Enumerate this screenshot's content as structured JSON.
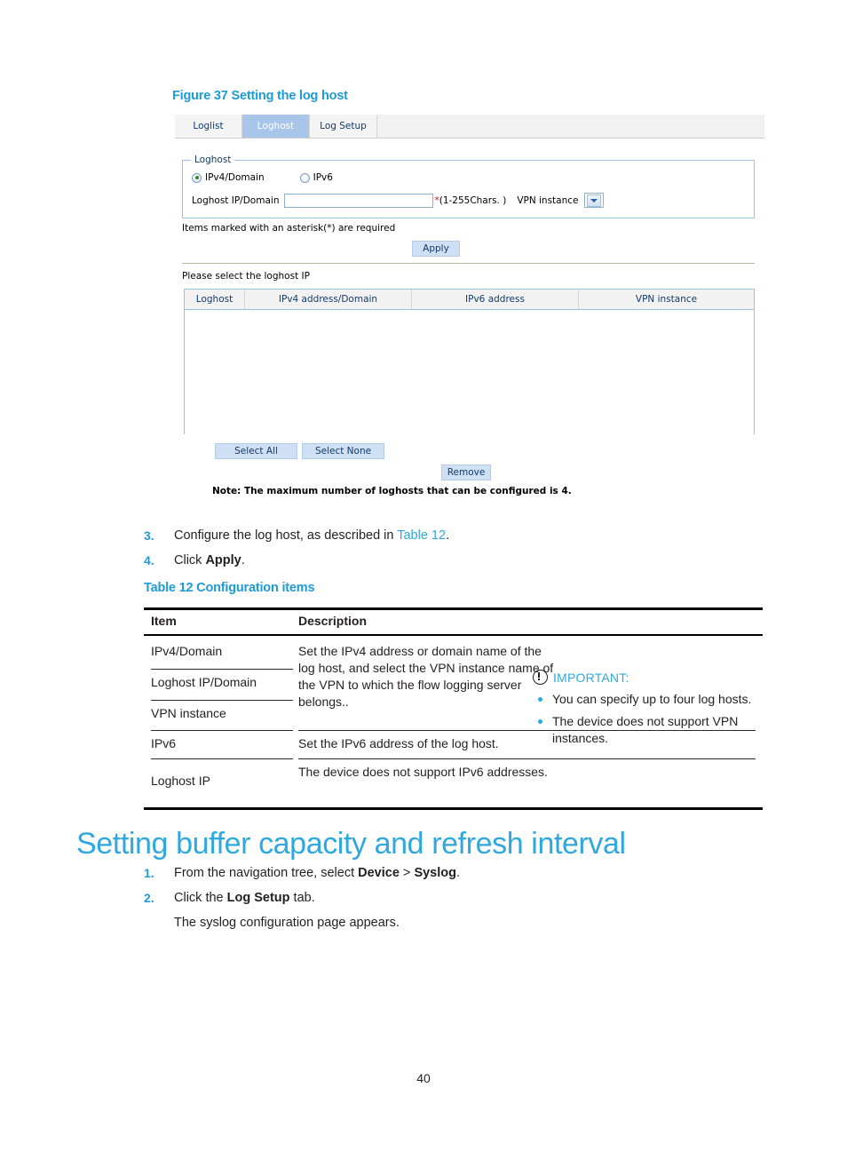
{
  "figure": {
    "caption": "Figure 37 Setting the log host",
    "tabs": [
      {
        "label": "Loglist",
        "active": false
      },
      {
        "label": "Loghost",
        "active": true
      },
      {
        "label": "Log Setup",
        "active": false
      }
    ],
    "fieldset": {
      "legend": "Loghost",
      "radios": [
        {
          "label": "IPv4/Domain",
          "checked": true
        },
        {
          "label": "IPv6",
          "checked": false
        }
      ],
      "field_label": "Loghost IP/Domain",
      "field_value": "",
      "field_placeholder": "",
      "asterisk": "*",
      "hint": "(1-255Chars. )",
      "vpn_label": "VPN instance",
      "vpn_value": ""
    },
    "required_note": "Items marked with an asterisk(*) are required",
    "apply_label": "Apply",
    "select_prompt": "Please select the loghost IP",
    "grid": {
      "headers": [
        "Loghost",
        "IPv4 address/Domain",
        "IPv6 address",
        "VPN instance"
      ],
      "rows": []
    },
    "select_all_label": "Select All",
    "select_none_label": "Select None",
    "remove_label": "Remove",
    "max_note": "Note: The maximum number of loghosts that can be configured is 4."
  },
  "steps_upper": [
    {
      "num": "3.",
      "text_before": "Configure the log host, as described in ",
      "link": "Table 12",
      "text_after": "."
    },
    {
      "num": "4.",
      "text_before": "Click ",
      "bold": "Apply",
      "text_after": "."
    }
  ],
  "table12": {
    "caption": "Table 12 Configuration items",
    "headers": {
      "item": "Item",
      "description": "Description"
    },
    "rows": [
      {
        "item": "IPv4/Domain"
      },
      {
        "item": "Loghost IP/Domain"
      },
      {
        "item": "VPN instance"
      },
      {
        "item": "IPv6"
      },
      {
        "item": "Loghost IP"
      }
    ],
    "descriptions": [
      "Set the IPv4 address or domain name of the log host, and select the VPN instance name of the VPN to which the flow logging server belongs..",
      "Set the IPv6 address of the log host.",
      "The device does not support IPv6 addresses."
    ]
  },
  "important": {
    "title": "IMPORTANT:",
    "items": [
      "You can specify up to four log hosts.",
      "The device does not support VPN instances."
    ]
  },
  "heading": "Setting buffer capacity and refresh interval",
  "steps_lower": [
    {
      "num": "1.",
      "text_before": "From the navigation tree, select ",
      "bold1": "Device",
      "mid": " > ",
      "bold2": "Syslog",
      "text_after": "."
    },
    {
      "num": "2.",
      "text_before": "Click the ",
      "bold1": "Log Setup",
      "text_after": " tab."
    }
  ],
  "steps_lower_note": "The syslog configuration page appears.",
  "page_number": "40",
  "colors": {
    "accent": "#2fa8df",
    "heading_blue": "#1e9bd7",
    "tab_active_bg": "#a8c6ea",
    "button_bg": "#cfe0f5",
    "required_red": "#d41414"
  }
}
